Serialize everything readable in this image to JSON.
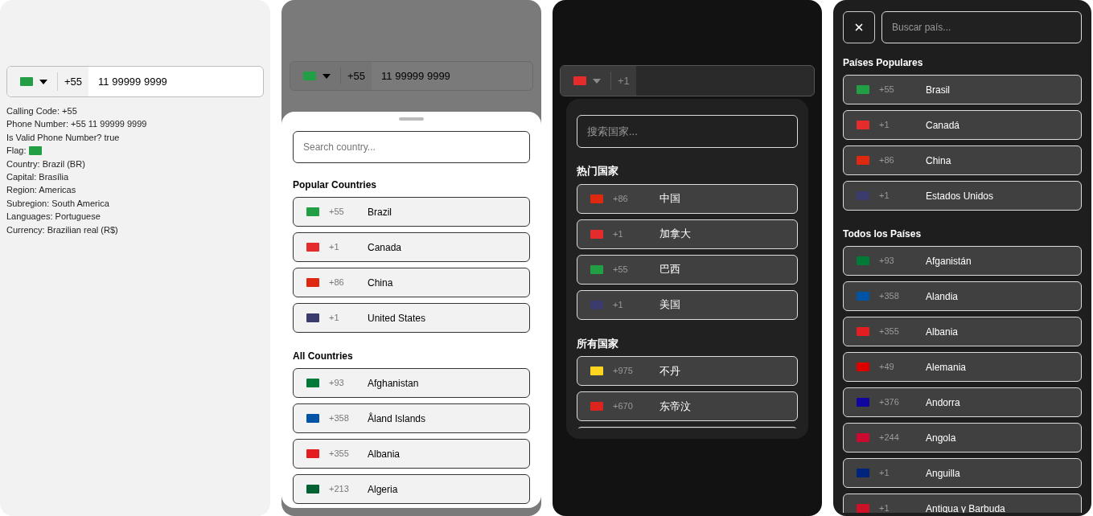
{
  "basic_demo": {
    "phone_input": {
      "color": "#229e45",
      "code": "+55",
      "value": "11 99999 9999"
    },
    "details": [
      {
        "kind": "text",
        "text": "Calling Code: +55"
      },
      {
        "kind": "text",
        "text": "Phone Number: +55 11 99999 9999"
      },
      {
        "kind": "text",
        "text": "Is Valid Phone Number? true"
      },
      {
        "kind": "flag",
        "text": "Flag:",
        "color": "#229e45"
      },
      {
        "kind": "text",
        "text": "Country: Brazil (BR)"
      },
      {
        "kind": "text",
        "text": "Capital: Brasília"
      },
      {
        "kind": "text",
        "text": "Region: Americas"
      },
      {
        "kind": "text",
        "text": "Subregion: South America"
      },
      {
        "kind": "text",
        "text": "Languages: Portuguese"
      },
      {
        "kind": "text",
        "text": "Currency: Brazilian real (R$)"
      }
    ]
  },
  "sheet_demo": {
    "phone_input": {
      "color": "#229e45",
      "code": "+55",
      "value": "11 99999 9999"
    },
    "search": {
      "placeholder": "Search country..."
    },
    "sections": [
      {
        "title": "Popular Countries",
        "countries": [
          {
            "code": "+55",
            "name": "Brazil",
            "color": "#229e45"
          },
          {
            "code": "+1",
            "name": "Canada",
            "color": "#e52b2b"
          },
          {
            "code": "+86",
            "name": "China",
            "color": "#de2910"
          },
          {
            "code": "+1",
            "name": "United States",
            "color": "#3c3b6e"
          }
        ]
      },
      {
        "title": "All Countries",
        "countries": [
          {
            "code": "+93",
            "name": "Afghanistan",
            "color": "#007a36"
          },
          {
            "code": "+358",
            "name": "Åland Islands",
            "color": "#0053a5"
          },
          {
            "code": "+355",
            "name": "Albania",
            "color": "#e41e20"
          },
          {
            "code": "+213",
            "name": "Algeria",
            "color": "#006233"
          }
        ]
      }
    ]
  },
  "dropdown_demo": {
    "phone_input": {
      "color": "#e52b2b",
      "code": "+1"
    },
    "search": {
      "placeholder": "搜索国家..."
    },
    "sections": [
      {
        "title": "热门国家",
        "countries": [
          {
            "code": "+86",
            "name": "中国",
            "color": "#de2910"
          },
          {
            "code": "+1",
            "name": "加拿大",
            "color": "#e52b2b"
          },
          {
            "code": "+55",
            "name": "巴西",
            "color": "#229e45"
          },
          {
            "code": "+1",
            "name": "美国",
            "color": "#3c3b6e"
          }
        ]
      },
      {
        "title": "所有国家",
        "countries": [
          {
            "code": "+975",
            "name": "不丹",
            "color": "#ffd520"
          },
          {
            "code": "+670",
            "name": "东帝汶",
            "color": "#dc241f"
          }
        ]
      }
    ]
  },
  "fullscreen_demo": {
    "search": {
      "placeholder": "Buscar país..."
    },
    "sections": [
      {
        "title": "Países Populares",
        "countries": [
          {
            "code": "+55",
            "name": "Brasil",
            "color": "#229e45"
          },
          {
            "code": "+1",
            "name": "Canadá",
            "color": "#e52b2b"
          },
          {
            "code": "+86",
            "name": "China",
            "color": "#de2910"
          },
          {
            "code": "+1",
            "name": "Estados Unidos",
            "color": "#3c3b6e"
          }
        ]
      },
      {
        "title": "Todos los Países",
        "countries": [
          {
            "code": "+93",
            "name": "Afganistán",
            "color": "#007a36"
          },
          {
            "code": "+358",
            "name": "Alandia",
            "color": "#0053a5"
          },
          {
            "code": "+355",
            "name": "Albania",
            "color": "#e41e20"
          },
          {
            "code": "+49",
            "name": "Alemania",
            "color": "#dd0000"
          },
          {
            "code": "+376",
            "name": "Andorra",
            "color": "#10069f"
          },
          {
            "code": "+244",
            "name": "Angola",
            "color": "#cc092f"
          },
          {
            "code": "+1",
            "name": "Anguilla",
            "color": "#00247d"
          },
          {
            "code": "+1",
            "name": "Antigua y Barbuda",
            "color": "#ce1126"
          }
        ]
      }
    ]
  }
}
